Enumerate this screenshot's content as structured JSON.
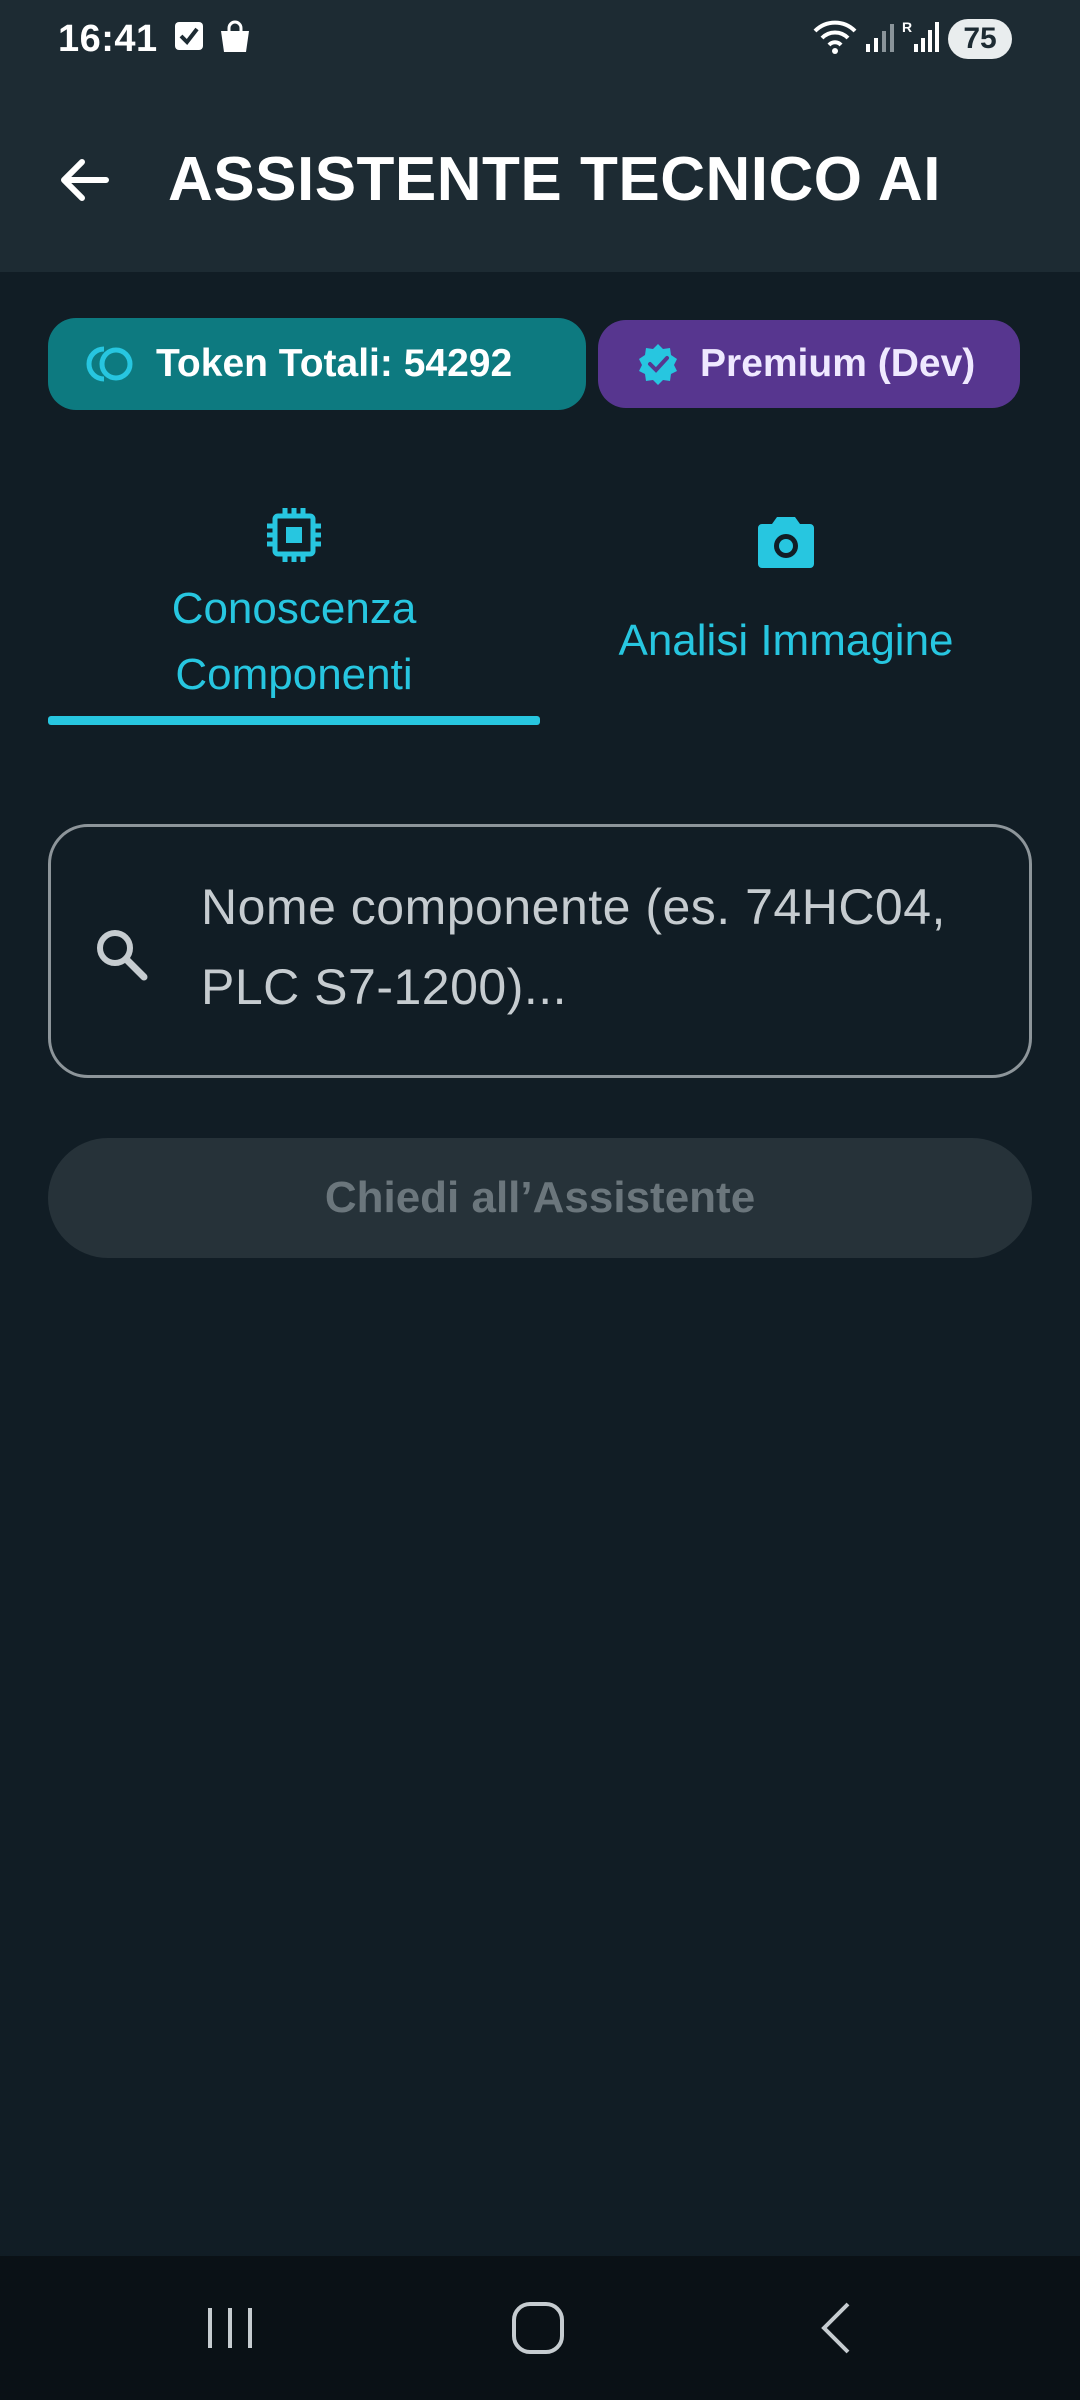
{
  "status_bar": {
    "time": "16:41",
    "battery": "75",
    "icons": [
      "check-notification-icon",
      "shopping-bag-icon",
      "wifi-icon",
      "signal-icon",
      "roaming-signal-icon"
    ]
  },
  "app_bar": {
    "title": "ASSISTENTE TECNICO AI",
    "back_icon": "arrow-left-icon"
  },
  "chips": {
    "tokens_label": "Token Totali: 54292",
    "premium_label": "Premium (Dev)"
  },
  "tabs": [
    {
      "line1": "Conoscenza",
      "line2": "Componenti",
      "icon": "chip-icon",
      "selected": true
    },
    {
      "line1": "Analisi Immagine",
      "icon": "camera-icon",
      "selected": false
    }
  ],
  "search": {
    "placeholder": "Nome componente (es. 74HC04, PLC S7-1200)..."
  },
  "ask_button": {
    "label": "Chiedi all’Assistente"
  },
  "nav_bar": [
    "recent-apps-icon",
    "home-icon",
    "back-icon"
  ],
  "colors": {
    "background": "#111d25",
    "app_bar": "#1d2b33",
    "accent": "#27c6e0",
    "token_chip": "#0d7a80",
    "premium_chip": "#57368f"
  }
}
